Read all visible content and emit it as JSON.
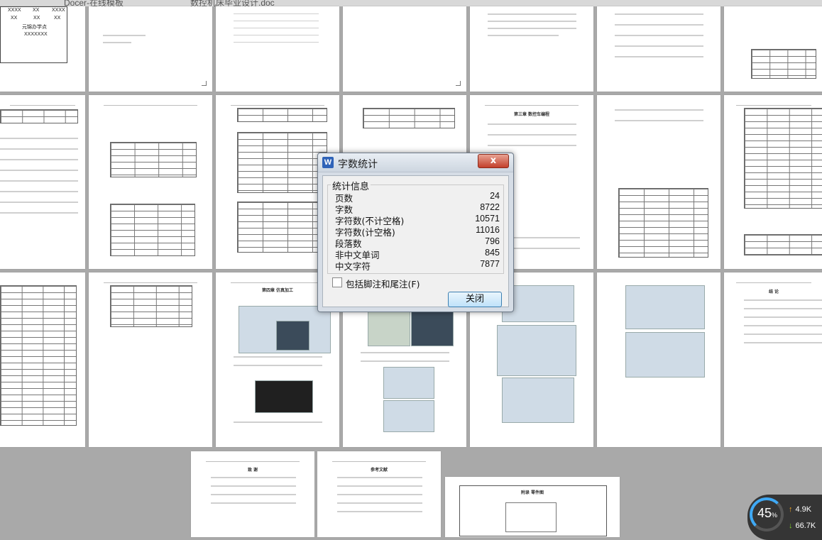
{
  "tabs": [
    {
      "label": "Docer-在线模板"
    },
    {
      "label": "数控机床毕业设计.doc"
    }
  ],
  "cover_page": {
    "cells": [
      "XXXX",
      "XX",
      "XXXX",
      "XX",
      "XX",
      "XX"
    ],
    "office": "元锦办学点",
    "code": "XXXXXXX"
  },
  "page_titles": {
    "chapter3": "第三章 数控车编程",
    "chapter4": "第四章 仿真加工",
    "conclusion": "结 论",
    "thanks": "致 谢",
    "references": "参考文献",
    "drawing": "附录 零件图"
  },
  "dialog": {
    "title": "字数统计",
    "app_icon": "W",
    "close_symbol": "x",
    "group_title": "统计信息",
    "stats": [
      {
        "label": "页数",
        "value": "24"
      },
      {
        "label": "字数",
        "value": "8722"
      },
      {
        "label": "字符数(不计空格)",
        "value": "10571"
      },
      {
        "label": "字符数(计空格)",
        "value": "11016"
      },
      {
        "label": "段落数",
        "value": "796"
      },
      {
        "label": "非中文单词",
        "value": "845"
      },
      {
        "label": "中文字符",
        "value": "7877"
      }
    ],
    "checkbox_label": "包括脚注和尾注(F)",
    "checkbox_checked": false,
    "close_button": "关闭"
  },
  "widget": {
    "percent": "45",
    "percent_unit": "%",
    "upload": "4.9K",
    "download": "66.7K",
    "up_arrow": "↑",
    "down_arrow": "↓"
  },
  "colors": {
    "workspace": "#a9a9a9",
    "dialog_frame": "#d6dde6",
    "close_button": "#c3402b",
    "gauge": "#3fa9f5"
  }
}
